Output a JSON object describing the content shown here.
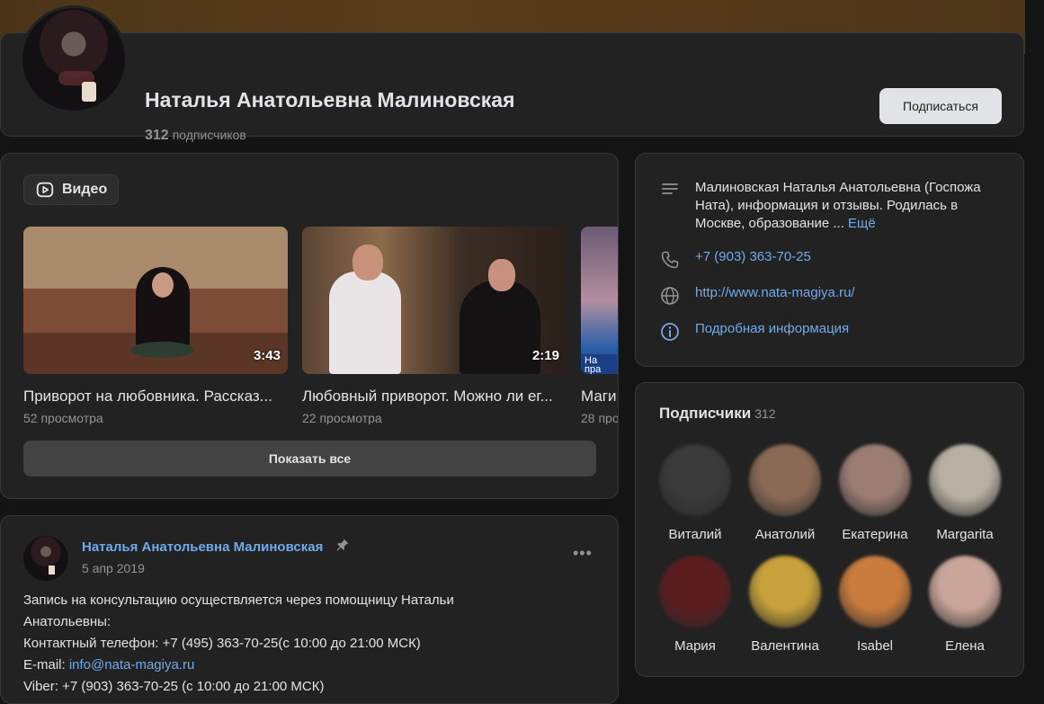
{
  "header": {
    "name": "Наталья Анатольевна Малиновская",
    "subscribers_count": "312",
    "subscribers_label": "подписчиков",
    "subscribe_button": "Подписаться"
  },
  "videos": {
    "section_label": "Видео",
    "items": [
      {
        "title": "Приворот на любовника. Рассказ...",
        "views": "52 просмотра",
        "duration": "3:43"
      },
      {
        "title": "Любовный приворот. Можно ли ег...",
        "views": "22 просмотра",
        "duration": "2:19"
      },
      {
        "title": "Маги",
        "views": "28 про",
        "duration": "",
        "tv_label": "На\nпра"
      }
    ],
    "show_all": "Показать все"
  },
  "post": {
    "author": "Наталья Анатольевна Малиновская",
    "date": "5 апр 2019",
    "line1": "Запись на консультацию осуществляется через помощницу Натальи",
    "line2": "Анатольевны:",
    "line3": "Контактный телефон: +7 (495) 363-70-25(с 10:00 до 21:00 МСК)",
    "email_prefix": "E-mail: ",
    "email": "info@nata-magiya.ru",
    "line5": "Viber: +7 (903) 363-70-25 (с 10:00 до 21:00 МСК)"
  },
  "info": {
    "description": "Малиновская Наталья Анатольевна (Госпожа Ната), информация и отзывы. Родилась в Москве, образование ...",
    "more_link": "Ещё",
    "phone": "+7 (903) 363-70-25",
    "website": "http://www.nata-magiya.ru/",
    "details": "Подробная информация"
  },
  "followers": {
    "title": "Подписчики",
    "count": "312",
    "people": [
      {
        "name": "Виталий",
        "color": "#3a3a3a"
      },
      {
        "name": "Анатолий",
        "color": "#8a6a55"
      },
      {
        "name": "Екатерина",
        "color": "#9c7d74"
      },
      {
        "name": "Margarita",
        "color": "#b8b0a2"
      },
      {
        "name": "Мария",
        "color": "#5c1d1f"
      },
      {
        "name": "Валентина",
        "color": "#c7a13b"
      },
      {
        "name": "Isabel",
        "color": "#c97c3d"
      },
      {
        "name": "Елена",
        "color": "#c9a59a"
      }
    ]
  },
  "colors": {
    "background": "#141414",
    "card": "#222222",
    "accent_link": "#71aaeb",
    "muted_text": "#939393",
    "cover": "#5a3e1c"
  }
}
